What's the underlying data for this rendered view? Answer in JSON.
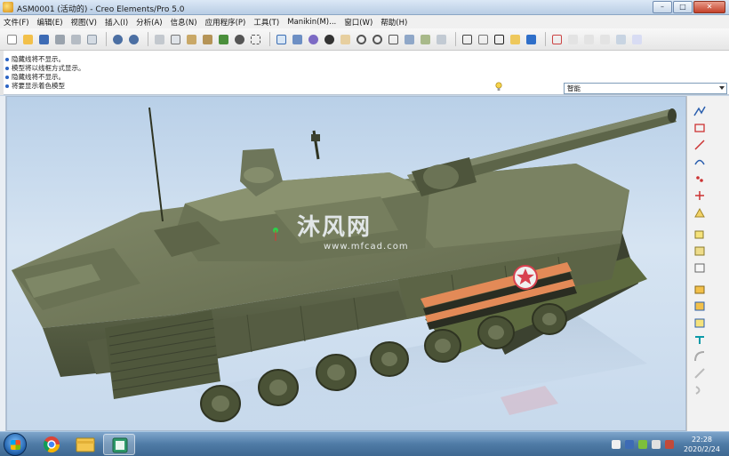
{
  "window": {
    "title": "ASM0001 (活动的) - Creo Elements/Pro 5.0",
    "controls": {
      "minimize": "–",
      "maximize": "□",
      "close": "✕"
    }
  },
  "menu": [
    "文件(F)",
    "编辑(E)",
    "视图(V)",
    "插入(I)",
    "分析(A)",
    "信息(N)",
    "应用程序(P)",
    "工具(T)",
    "Manikin(M)...",
    "窗口(W)",
    "帮助(H)"
  ],
  "messages": [
    "隐藏线将不显示。",
    "模型将以线框方式显示。",
    "隐藏线将不显示。",
    "将要显示着色模型"
  ],
  "filter": {
    "selected": "智能"
  },
  "watermark": {
    "logo": "沐风网",
    "url": "www.mfcad.com"
  },
  "taskbar": {
    "clock_time": "22:28",
    "clock_date": "2020/2/24",
    "apps": [
      "chrome-icon",
      "file-explorer-icon",
      "creo-icon"
    ]
  },
  "colors": {
    "hull": "#5a6247",
    "hull_light": "#747c5d",
    "hull_dark": "#3c4230",
    "stripe_orange": "#e38a57",
    "star_red": "#d8414f"
  }
}
